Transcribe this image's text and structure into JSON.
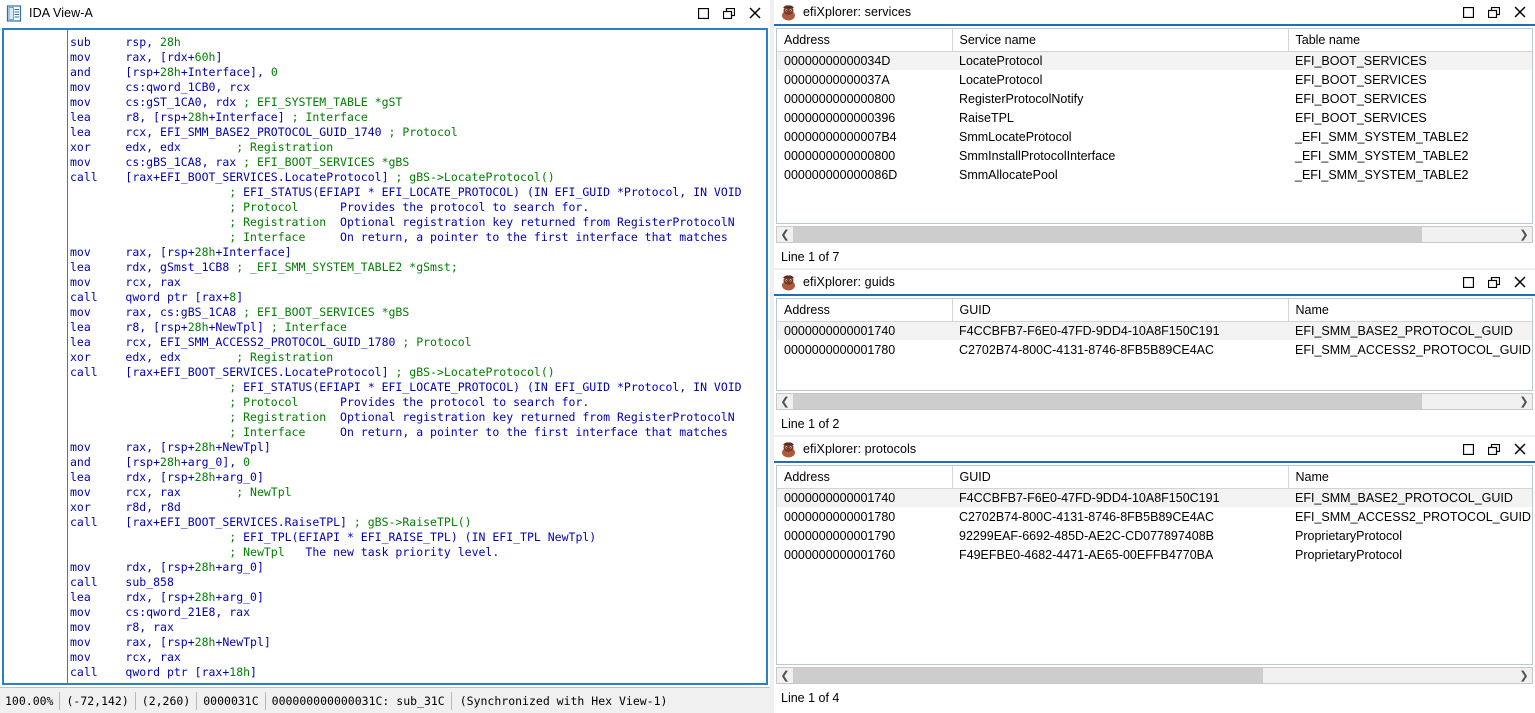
{
  "ida_view": {
    "title": "IDA View-A",
    "icon": "document-view-icon",
    "window_buttons": [
      "restore-icon",
      "maximize-icon",
      "close-icon"
    ],
    "code_lines": [
      [
        [
          "mn",
          "sub"
        ],
        [
          "sp",
          "     "
        ],
        [
          "rg",
          "rsp, "
        ],
        [
          "nm",
          "28h"
        ]
      ],
      [
        [
          "mn",
          "mov"
        ],
        [
          "sp",
          "     "
        ],
        [
          "rg",
          "rax, [rdx+"
        ],
        [
          "nm",
          "60h"
        ],
        [
          "rg",
          "]"
        ]
      ],
      [
        [
          "mn",
          "and"
        ],
        [
          "sp",
          "     "
        ],
        [
          "rg",
          "[rsp+"
        ],
        [
          "nm",
          "28h"
        ],
        [
          "rg",
          "+Interface], "
        ],
        [
          "nm",
          "0"
        ]
      ],
      [
        [
          "mn",
          "mov"
        ],
        [
          "sp",
          "     "
        ],
        [
          "rg",
          "cs:qword_1CB0, rcx"
        ]
      ],
      [
        [
          "mn",
          "mov"
        ],
        [
          "sp",
          "     "
        ],
        [
          "rg",
          "cs:gST_1CA0, rdx "
        ],
        [
          "cm",
          "; EFI_SYSTEM_TABLE *gST"
        ]
      ],
      [
        [
          "mn",
          "lea"
        ],
        [
          "sp",
          "     "
        ],
        [
          "rg",
          "r8, [rsp+"
        ],
        [
          "nm",
          "28h"
        ],
        [
          "rg",
          "+Interface] "
        ],
        [
          "cm",
          "; Interface"
        ]
      ],
      [
        [
          "mn",
          "lea"
        ],
        [
          "sp",
          "     "
        ],
        [
          "rg",
          "rcx, EFI_SMM_BASE2_PROTOCOL_GUID_1740 "
        ],
        [
          "cm",
          "; Protocol"
        ]
      ],
      [
        [
          "mn",
          "xor"
        ],
        [
          "sp",
          "     "
        ],
        [
          "rg",
          "edx, edx        "
        ],
        [
          "cm",
          "; Registration"
        ]
      ],
      [
        [
          "mn",
          "mov"
        ],
        [
          "sp",
          "     "
        ],
        [
          "rg",
          "cs:gBS_1CA8, rax "
        ],
        [
          "cm",
          "; EFI_BOOT_SERVICES *gBS"
        ]
      ],
      [
        [
          "mn",
          "call"
        ],
        [
          "sp",
          "    "
        ],
        [
          "rg",
          "[rax+EFI_BOOT_SERVICES.LocateProtocol] "
        ],
        [
          "cm",
          "; gBS->LocateProtocol()"
        ]
      ],
      [
        [
          "sp",
          "                       "
        ],
        [
          "cm",
          "; "
        ],
        [
          "cmb",
          "EFI_STATUS(EFIAPI * EFI_LOCATE_PROTOCOL) (IN EFI_GUID *Protocol, IN VOID"
        ]
      ],
      [
        [
          "sp",
          "                       "
        ],
        [
          "cm",
          "; Protocol      "
        ],
        [
          "cmb",
          "Provides the protocol to search for."
        ]
      ],
      [
        [
          "sp",
          "                       "
        ],
        [
          "cm",
          "; Registration  "
        ],
        [
          "cmb",
          "Optional registration key returned from RegisterProtocolN"
        ]
      ],
      [
        [
          "sp",
          "                       "
        ],
        [
          "cm",
          "; Interface     "
        ],
        [
          "cmb",
          "On return, a pointer to the first interface that matches "
        ]
      ],
      [
        [
          "mn",
          "mov"
        ],
        [
          "sp",
          "     "
        ],
        [
          "rg",
          "rax, [rsp+"
        ],
        [
          "nm",
          "28h"
        ],
        [
          "rg",
          "+Interface]"
        ]
      ],
      [
        [
          "mn",
          "lea"
        ],
        [
          "sp",
          "     "
        ],
        [
          "rg",
          "rdx, gSmst_1CB8 "
        ],
        [
          "cm",
          "; _EFI_SMM_SYSTEM_TABLE2 *gSmst;"
        ]
      ],
      [
        [
          "mn",
          "mov"
        ],
        [
          "sp",
          "     "
        ],
        [
          "rg",
          "rcx, rax"
        ]
      ],
      [
        [
          "mn",
          "call"
        ],
        [
          "sp",
          "    "
        ],
        [
          "rg",
          "qword ptr [rax+"
        ],
        [
          "nm",
          "8"
        ],
        [
          "rg",
          "]"
        ]
      ],
      [
        [
          "mn",
          "mov"
        ],
        [
          "sp",
          "     "
        ],
        [
          "rg",
          "rax, cs:gBS_1CA8 "
        ],
        [
          "cm",
          "; EFI_BOOT_SERVICES *gBS"
        ]
      ],
      [
        [
          "mn",
          "lea"
        ],
        [
          "sp",
          "     "
        ],
        [
          "rg",
          "r8, [rsp+"
        ],
        [
          "nm",
          "28h"
        ],
        [
          "rg",
          "+NewTpl] "
        ],
        [
          "cm",
          "; Interface"
        ]
      ],
      [
        [
          "mn",
          "lea"
        ],
        [
          "sp",
          "     "
        ],
        [
          "rg",
          "rcx, EFI_SMM_ACCESS2_PROTOCOL_GUID_1780 "
        ],
        [
          "cm",
          "; Protocol"
        ]
      ],
      [
        [
          "mn",
          "xor"
        ],
        [
          "sp",
          "     "
        ],
        [
          "rg",
          "edx, edx        "
        ],
        [
          "cm",
          "; Registration"
        ]
      ],
      [
        [
          "mn",
          "call"
        ],
        [
          "sp",
          "    "
        ],
        [
          "rg",
          "[rax+EFI_BOOT_SERVICES.LocateProtocol] "
        ],
        [
          "cm",
          "; gBS->LocateProtocol()"
        ]
      ],
      [
        [
          "sp",
          "                       "
        ],
        [
          "cm",
          "; "
        ],
        [
          "cmb",
          "EFI_STATUS(EFIAPI * EFI_LOCATE_PROTOCOL) (IN EFI_GUID *Protocol, IN VOID"
        ]
      ],
      [
        [
          "sp",
          "                       "
        ],
        [
          "cm",
          "; Protocol      "
        ],
        [
          "cmb",
          "Provides the protocol to search for."
        ]
      ],
      [
        [
          "sp",
          "                       "
        ],
        [
          "cm",
          "; Registration  "
        ],
        [
          "cmb",
          "Optional registration key returned from RegisterProtocolN"
        ]
      ],
      [
        [
          "sp",
          "                       "
        ],
        [
          "cm",
          "; Interface     "
        ],
        [
          "cmb",
          "On return, a pointer to the first interface that matches "
        ]
      ],
      [
        [
          "mn",
          "mov"
        ],
        [
          "sp",
          "     "
        ],
        [
          "rg",
          "rax, [rsp+"
        ],
        [
          "nm",
          "28h"
        ],
        [
          "rg",
          "+NewTpl]"
        ]
      ],
      [
        [
          "mn",
          "and"
        ],
        [
          "sp",
          "     "
        ],
        [
          "rg",
          "[rsp+"
        ],
        [
          "nm",
          "28h"
        ],
        [
          "rg",
          "+arg_0], "
        ],
        [
          "nm",
          "0"
        ]
      ],
      [
        [
          "mn",
          "lea"
        ],
        [
          "sp",
          "     "
        ],
        [
          "rg",
          "rdx, [rsp+"
        ],
        [
          "nm",
          "28h"
        ],
        [
          "rg",
          "+arg_0]"
        ]
      ],
      [
        [
          "mn",
          "mov"
        ],
        [
          "sp",
          "     "
        ],
        [
          "rg",
          "rcx, rax        "
        ],
        [
          "cm",
          "; NewTpl"
        ]
      ],
      [
        [
          "mn",
          "xor"
        ],
        [
          "sp",
          "     "
        ],
        [
          "rg",
          "r8d, r8d"
        ]
      ],
      [
        [
          "mn",
          "call"
        ],
        [
          "sp",
          "    "
        ],
        [
          "rg",
          "[rax+EFI_BOOT_SERVICES.RaiseTPL] "
        ],
        [
          "cm",
          "; gBS->RaiseTPL()"
        ]
      ],
      [
        [
          "sp",
          "                       "
        ],
        [
          "cm",
          "; "
        ],
        [
          "cmb",
          "EFI_TPL(EFIAPI * EFI_RAISE_TPL) (IN EFI_TPL NewTpl)"
        ]
      ],
      [
        [
          "sp",
          "                       "
        ],
        [
          "cm",
          "; NewTpl   "
        ],
        [
          "cmb",
          "The new task priority level."
        ]
      ],
      [
        [
          "mn",
          "mov"
        ],
        [
          "sp",
          "     "
        ],
        [
          "rg",
          "rdx, [rsp+"
        ],
        [
          "nm",
          "28h"
        ],
        [
          "rg",
          "+arg_0]"
        ]
      ],
      [
        [
          "mn",
          "call"
        ],
        [
          "sp",
          "    "
        ],
        [
          "rg",
          "sub_858"
        ]
      ],
      [
        [
          "mn",
          "lea"
        ],
        [
          "sp",
          "     "
        ],
        [
          "rg",
          "rdx, [rsp+"
        ],
        [
          "nm",
          "28h"
        ],
        [
          "rg",
          "+arg_0]"
        ]
      ],
      [
        [
          "mn",
          "mov"
        ],
        [
          "sp",
          "     "
        ],
        [
          "rg",
          "cs:qword_21E8, rax"
        ]
      ],
      [
        [
          "mn",
          "mov"
        ],
        [
          "sp",
          "     "
        ],
        [
          "rg",
          "r8, rax"
        ]
      ],
      [
        [
          "mn",
          "mov"
        ],
        [
          "sp",
          "     "
        ],
        [
          "rg",
          "rax, [rsp+"
        ],
        [
          "nm",
          "28h"
        ],
        [
          "rg",
          "+NewTpl]"
        ]
      ],
      [
        [
          "mn",
          "mov"
        ],
        [
          "sp",
          "     "
        ],
        [
          "rg",
          "rcx, rax"
        ]
      ],
      [
        [
          "mn",
          "call"
        ],
        [
          "sp",
          "    "
        ],
        [
          "rg",
          "qword ptr [rax+"
        ],
        [
          "nm",
          "18h"
        ],
        [
          "rg",
          "]"
        ]
      ]
    ],
    "status_bar": {
      "zoom": "100.00%",
      "coords1": "(-72,142)",
      "coords2": "(2,260)",
      "offset": "0000031C",
      "address_label": "000000000000031C: sub_31C",
      "sync": "(Synchronized with Hex View-1)"
    }
  },
  "services_panel": {
    "title": "efiXplorer: services",
    "icon": "efixplorer-icon",
    "window_buttons": [
      "restore-icon",
      "maximize-icon",
      "close-icon"
    ],
    "columns": [
      "Address",
      "Service name",
      "Table name"
    ],
    "rows": [
      [
        "00000000000034D",
        "LocateProtocol",
        "EFI_BOOT_SERVICES"
      ],
      [
        "00000000000037A",
        "LocateProtocol",
        "EFI_BOOT_SERVICES"
      ],
      [
        "0000000000000800",
        "RegisterProtocolNotify",
        "EFI_BOOT_SERVICES"
      ],
      [
        "0000000000000396",
        "RaiseTPL",
        "EFI_BOOT_SERVICES"
      ],
      [
        "00000000000007B4",
        "SmmLocateProtocol",
        "_EFI_SMM_SYSTEM_TABLE2"
      ],
      [
        "0000000000000800",
        "SmmInstallProtocolInterface",
        "_EFI_SMM_SYSTEM_TABLE2"
      ],
      [
        "000000000000086D",
        "SmmAllocatePool",
        "_EFI_SMM_SYSTEM_TABLE2"
      ]
    ],
    "status": "Line 1 of 7",
    "scroll_left_arrow": "chevron-left-icon",
    "scroll_right_arrow": "chevron-right-icon"
  },
  "guids_panel": {
    "title": "efiXplorer: guids",
    "icon": "efixplorer-icon",
    "window_buttons": [
      "restore-icon",
      "maximize-icon",
      "close-icon"
    ],
    "columns": [
      "Address",
      "GUID",
      "Name"
    ],
    "rows": [
      [
        "0000000000001740",
        "F4CCBFB7-F6E0-47FD-9DD4-10A8F150C191",
        "EFI_SMM_BASE2_PROTOCOL_GUID"
      ],
      [
        "0000000000001780",
        "C2702B74-800C-4131-8746-8FB5B89CE4AC",
        "EFI_SMM_ACCESS2_PROTOCOL_GUID"
      ]
    ],
    "status": "Line 1 of 2",
    "scroll_left_arrow": "chevron-left-icon",
    "scroll_right_arrow": "chevron-right-icon"
  },
  "protocols_panel": {
    "title": "efiXplorer: protocols",
    "icon": "efixplorer-icon",
    "window_buttons": [
      "restore-icon",
      "maximize-icon",
      "close-icon"
    ],
    "columns": [
      "Address",
      "GUID",
      "Name"
    ],
    "rows": [
      [
        "0000000000001740",
        "F4CCBFB7-F6E0-47FD-9DD4-10A8F150C191",
        "EFI_SMM_BASE2_PROTOCOL_GUID"
      ],
      [
        "0000000000001780",
        "C2702B74-800C-4131-8746-8FB5B89CE4AC",
        "EFI_SMM_ACCESS2_PROTOCOL_GUID"
      ],
      [
        "0000000000001790",
        "92299EAF-6692-485D-AE2C-CD077897408B",
        "ProprietaryProtocol"
      ],
      [
        "0000000000001760",
        "F49EFBE0-4682-4471-AE65-00EFFB4770BA",
        "ProprietaryProtocol"
      ]
    ],
    "status": "Line 1 of 4",
    "scroll_left_arrow": "chevron-left-icon",
    "scroll_right_arrow": "chevron-right-icon"
  },
  "colors": {
    "title_underline": "#1e6fba",
    "code_blue": "#0000c0",
    "code_green": "#008000",
    "row_alt": "#f3f3f3",
    "chrome": "#f0f0f0"
  }
}
